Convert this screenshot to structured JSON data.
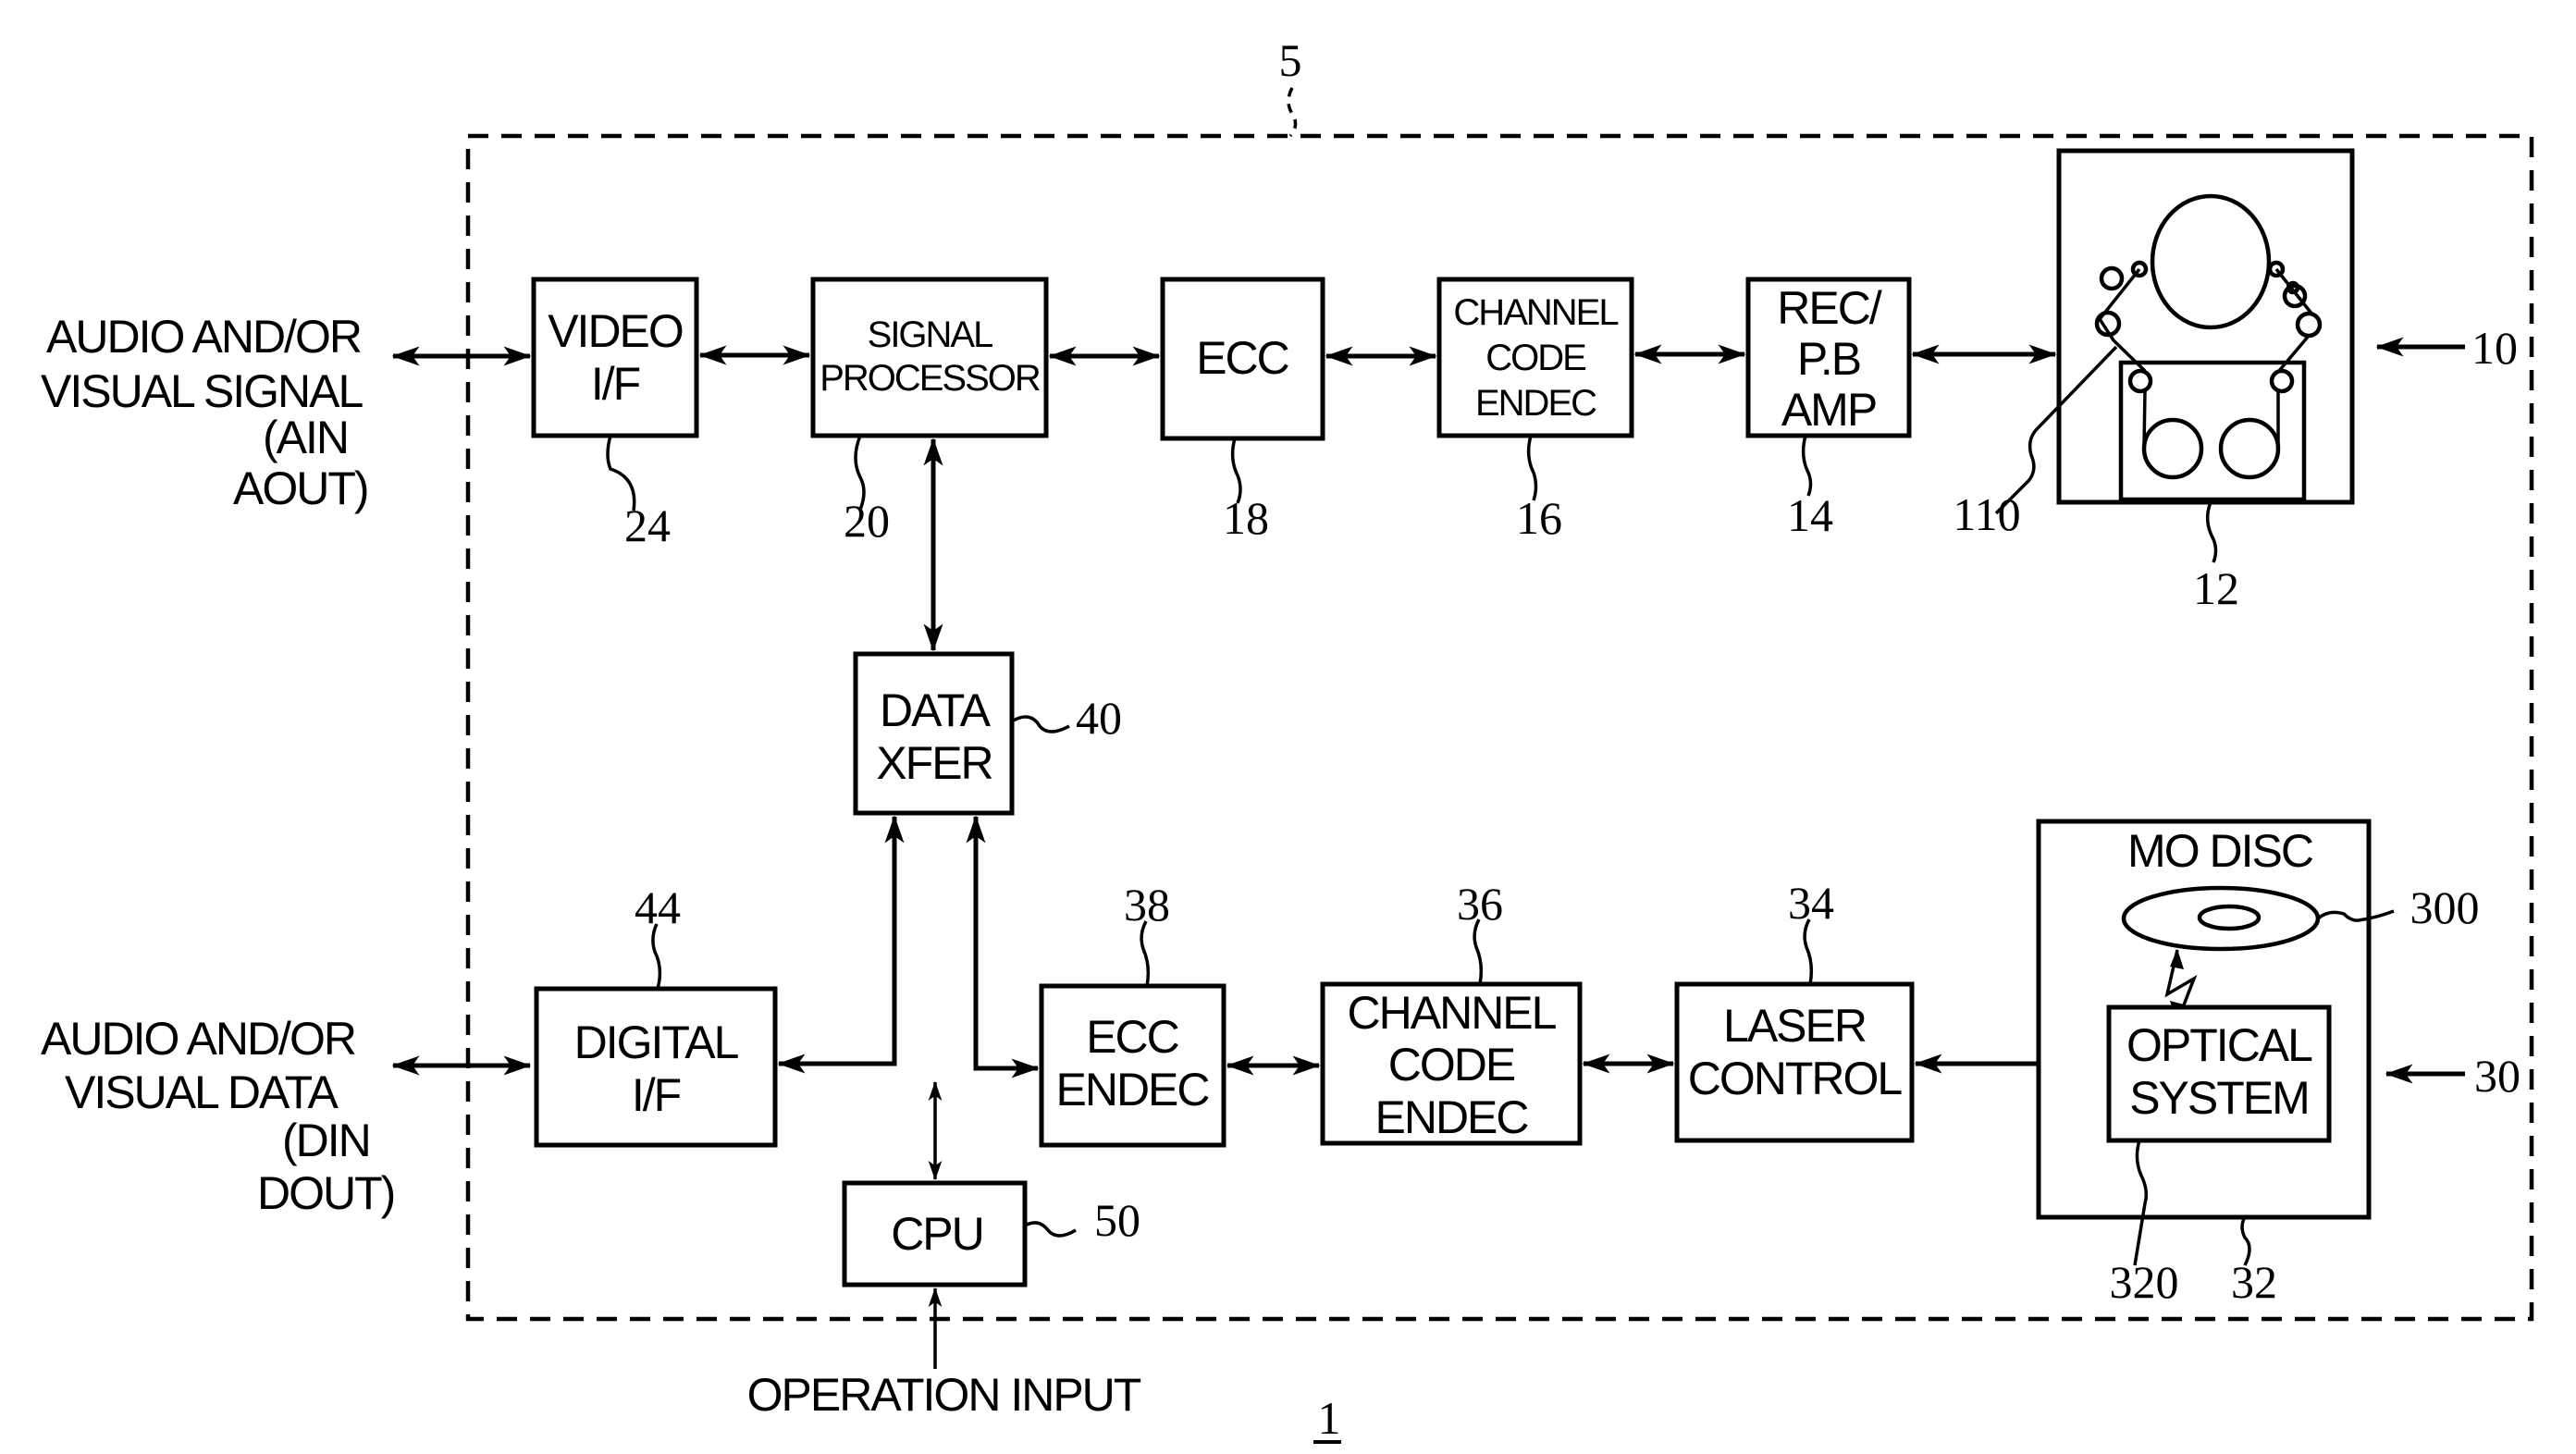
{
  "figure": {
    "number": "1",
    "system_ref": "5"
  },
  "external": {
    "signal_input": [
      "AUDIO AND/OR",
      "VISUAL SIGNAL",
      "(AIN",
      "AOUT)"
    ],
    "data_input": [
      "AUDIO AND/OR",
      "VISUAL DATA",
      "(DIN",
      "DOUT)"
    ],
    "operation_input": "OPERATION INPUT"
  },
  "blocks": {
    "video_if": {
      "lines": [
        "VIDEO",
        "I/F"
      ],
      "ref": "24"
    },
    "signal_processor": {
      "lines": [
        "SIGNAL",
        "PROCESSOR"
      ],
      "ref": "20"
    },
    "ecc": {
      "lines": [
        "ECC"
      ],
      "ref": "18"
    },
    "channel_code_top": {
      "lines": [
        "CHANNEL",
        "CODE",
        "ENDEC"
      ],
      "ref": "16"
    },
    "rec_pb_amp": {
      "lines": [
        "REC/",
        "P.B",
        "AMP"
      ],
      "ref": "14"
    },
    "tape_deck": {
      "ref": "12",
      "head_ref": "110",
      "unit_ref": "10"
    },
    "data_xfer": {
      "lines": [
        "DATA",
        "XFER"
      ],
      "ref": "40"
    },
    "digital_if": {
      "lines": [
        "DIGITAL",
        "I/F"
      ],
      "ref": "44"
    },
    "ecc_endec": {
      "lines": [
        "ECC",
        "ENDEC"
      ],
      "ref": "38"
    },
    "channel_code_bottom": {
      "lines": [
        "CHANNEL",
        "CODE",
        "ENDEC"
      ],
      "ref": "36"
    },
    "laser_control": {
      "lines": [
        "LASER",
        "CONTROL"
      ],
      "ref": "34"
    },
    "mo_unit": {
      "title": "MO DISC",
      "ref": "32",
      "disc_ref": "300",
      "unit_ref": "30"
    },
    "optical_system": {
      "lines": [
        "OPTICAL",
        "SYSTEM"
      ],
      "ref": "320"
    },
    "cpu": {
      "lines": [
        "CPU"
      ],
      "ref": "50"
    }
  }
}
